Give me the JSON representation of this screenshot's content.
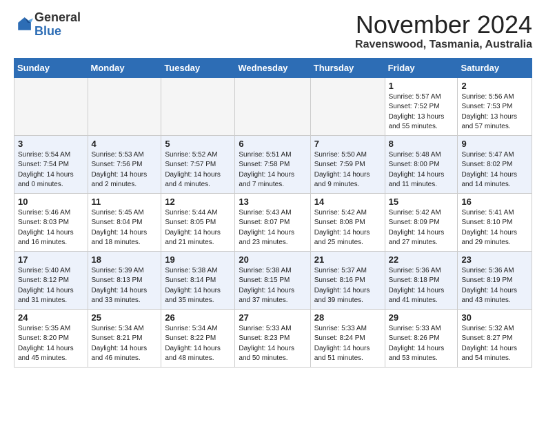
{
  "header": {
    "logo_line1": "General",
    "logo_line2": "Blue",
    "month": "November 2024",
    "location": "Ravenswood, Tasmania, Australia"
  },
  "weekdays": [
    "Sunday",
    "Monday",
    "Tuesday",
    "Wednesday",
    "Thursday",
    "Friday",
    "Saturday"
  ],
  "weeks": [
    [
      {
        "day": "",
        "info": ""
      },
      {
        "day": "",
        "info": ""
      },
      {
        "day": "",
        "info": ""
      },
      {
        "day": "",
        "info": ""
      },
      {
        "day": "",
        "info": ""
      },
      {
        "day": "1",
        "info": "Sunrise: 5:57 AM\nSunset: 7:52 PM\nDaylight: 13 hours\nand 55 minutes."
      },
      {
        "day": "2",
        "info": "Sunrise: 5:56 AM\nSunset: 7:53 PM\nDaylight: 13 hours\nand 57 minutes."
      }
    ],
    [
      {
        "day": "3",
        "info": "Sunrise: 5:54 AM\nSunset: 7:54 PM\nDaylight: 14 hours\nand 0 minutes."
      },
      {
        "day": "4",
        "info": "Sunrise: 5:53 AM\nSunset: 7:56 PM\nDaylight: 14 hours\nand 2 minutes."
      },
      {
        "day": "5",
        "info": "Sunrise: 5:52 AM\nSunset: 7:57 PM\nDaylight: 14 hours\nand 4 minutes."
      },
      {
        "day": "6",
        "info": "Sunrise: 5:51 AM\nSunset: 7:58 PM\nDaylight: 14 hours\nand 7 minutes."
      },
      {
        "day": "7",
        "info": "Sunrise: 5:50 AM\nSunset: 7:59 PM\nDaylight: 14 hours\nand 9 minutes."
      },
      {
        "day": "8",
        "info": "Sunrise: 5:48 AM\nSunset: 8:00 PM\nDaylight: 14 hours\nand 11 minutes."
      },
      {
        "day": "9",
        "info": "Sunrise: 5:47 AM\nSunset: 8:02 PM\nDaylight: 14 hours\nand 14 minutes."
      }
    ],
    [
      {
        "day": "10",
        "info": "Sunrise: 5:46 AM\nSunset: 8:03 PM\nDaylight: 14 hours\nand 16 minutes."
      },
      {
        "day": "11",
        "info": "Sunrise: 5:45 AM\nSunset: 8:04 PM\nDaylight: 14 hours\nand 18 minutes."
      },
      {
        "day": "12",
        "info": "Sunrise: 5:44 AM\nSunset: 8:05 PM\nDaylight: 14 hours\nand 21 minutes."
      },
      {
        "day": "13",
        "info": "Sunrise: 5:43 AM\nSunset: 8:07 PM\nDaylight: 14 hours\nand 23 minutes."
      },
      {
        "day": "14",
        "info": "Sunrise: 5:42 AM\nSunset: 8:08 PM\nDaylight: 14 hours\nand 25 minutes."
      },
      {
        "day": "15",
        "info": "Sunrise: 5:42 AM\nSunset: 8:09 PM\nDaylight: 14 hours\nand 27 minutes."
      },
      {
        "day": "16",
        "info": "Sunrise: 5:41 AM\nSunset: 8:10 PM\nDaylight: 14 hours\nand 29 minutes."
      }
    ],
    [
      {
        "day": "17",
        "info": "Sunrise: 5:40 AM\nSunset: 8:12 PM\nDaylight: 14 hours\nand 31 minutes."
      },
      {
        "day": "18",
        "info": "Sunrise: 5:39 AM\nSunset: 8:13 PM\nDaylight: 14 hours\nand 33 minutes."
      },
      {
        "day": "19",
        "info": "Sunrise: 5:38 AM\nSunset: 8:14 PM\nDaylight: 14 hours\nand 35 minutes."
      },
      {
        "day": "20",
        "info": "Sunrise: 5:38 AM\nSunset: 8:15 PM\nDaylight: 14 hours\nand 37 minutes."
      },
      {
        "day": "21",
        "info": "Sunrise: 5:37 AM\nSunset: 8:16 PM\nDaylight: 14 hours\nand 39 minutes."
      },
      {
        "day": "22",
        "info": "Sunrise: 5:36 AM\nSunset: 8:18 PM\nDaylight: 14 hours\nand 41 minutes."
      },
      {
        "day": "23",
        "info": "Sunrise: 5:36 AM\nSunset: 8:19 PM\nDaylight: 14 hours\nand 43 minutes."
      }
    ],
    [
      {
        "day": "24",
        "info": "Sunrise: 5:35 AM\nSunset: 8:20 PM\nDaylight: 14 hours\nand 45 minutes."
      },
      {
        "day": "25",
        "info": "Sunrise: 5:34 AM\nSunset: 8:21 PM\nDaylight: 14 hours\nand 46 minutes."
      },
      {
        "day": "26",
        "info": "Sunrise: 5:34 AM\nSunset: 8:22 PM\nDaylight: 14 hours\nand 48 minutes."
      },
      {
        "day": "27",
        "info": "Sunrise: 5:33 AM\nSunset: 8:23 PM\nDaylight: 14 hours\nand 50 minutes."
      },
      {
        "day": "28",
        "info": "Sunrise: 5:33 AM\nSunset: 8:24 PM\nDaylight: 14 hours\nand 51 minutes."
      },
      {
        "day": "29",
        "info": "Sunrise: 5:33 AM\nSunset: 8:26 PM\nDaylight: 14 hours\nand 53 minutes."
      },
      {
        "day": "30",
        "info": "Sunrise: 5:32 AM\nSunset: 8:27 PM\nDaylight: 14 hours\nand 54 minutes."
      }
    ]
  ]
}
